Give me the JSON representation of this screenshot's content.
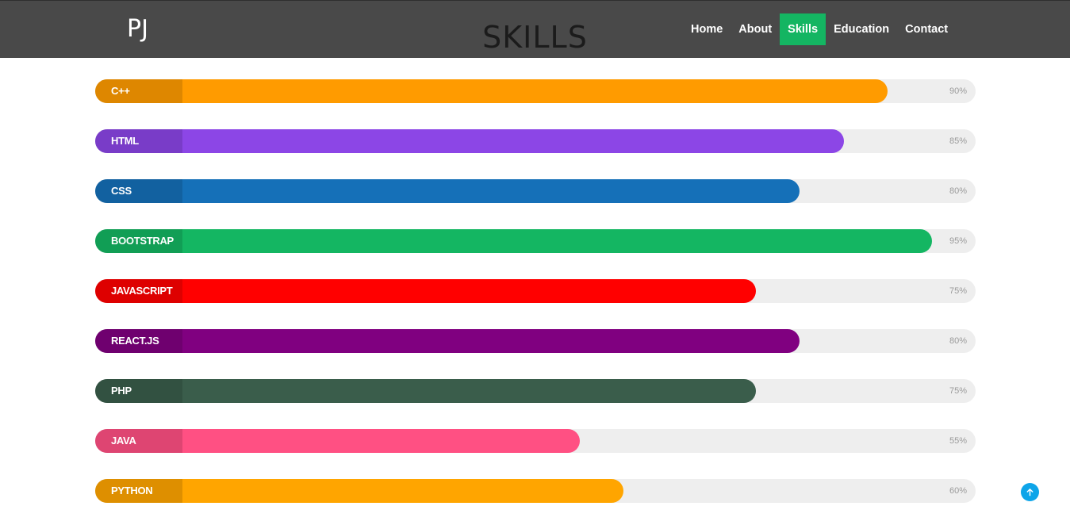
{
  "nav": {
    "logo": "PJ",
    "items": [
      {
        "label": "Home",
        "active": false
      },
      {
        "label": "About",
        "active": false
      },
      {
        "label": "Skills",
        "active": true
      },
      {
        "label": "Education",
        "active": false
      },
      {
        "label": "Contact",
        "active": false
      }
    ],
    "active_color": "#14b562",
    "background_color": "#494949"
  },
  "page": {
    "title": "SKILLS"
  },
  "skills": [
    {
      "name": "C++",
      "percent_label": "90%",
      "level": 0.9,
      "color": "#ff9b00"
    },
    {
      "name": "HTML",
      "percent_label": "85%",
      "level": 0.85,
      "color": "#8c46e6"
    },
    {
      "name": "CSS",
      "percent_label": "80%",
      "level": 0.8,
      "color": "#1570b8"
    },
    {
      "name": "BOOTSTRAP",
      "percent_label": "95%",
      "level": 0.95,
      "color": "#14b662"
    },
    {
      "name": "JAVASCRIPT",
      "percent_label": "75%",
      "level": 0.75,
      "color": "#ff0000"
    },
    {
      "name": "REACT.JS",
      "percent_label": "80%",
      "level": 0.8,
      "color": "#800080"
    },
    {
      "name": "PHP",
      "percent_label": "75%",
      "level": 0.75,
      "color": "#3a5d4b"
    },
    {
      "name": "JAVA",
      "percent_label": "55%",
      "level": 0.55,
      "color": "#ff5083"
    },
    {
      "name": "PYTHON",
      "percent_label": "60%",
      "level": 0.6,
      "color": "#ffa500"
    }
  ],
  "back_to_top": {
    "icon": "arrow-up-icon",
    "color": "#0ea5e9"
  }
}
